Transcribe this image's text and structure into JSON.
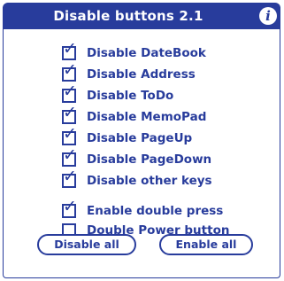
{
  "app": {
    "title": "Disable buttons 2.1",
    "info_icon_glyph": "i"
  },
  "options": [
    {
      "label": "Disable DateBook",
      "checked": true
    },
    {
      "label": "Disable Address",
      "checked": true
    },
    {
      "label": "Disable ToDo",
      "checked": true
    },
    {
      "label": "Disable MemoPad",
      "checked": true
    },
    {
      "label": "Disable PageUp",
      "checked": true
    },
    {
      "label": "Disable PageDown",
      "checked": true
    },
    {
      "label": "Disable other keys",
      "checked": true
    },
    {
      "label": "Enable double press",
      "checked": true
    },
    {
      "label": "Double Power button",
      "checked": false
    }
  ],
  "buttons": {
    "disable_all": "Disable all",
    "enable_all": "Enable all"
  },
  "colors": {
    "accent": "#283c9c",
    "background": "#ffffff"
  },
  "icons": {
    "info": "info-icon",
    "checkbox_checked": "checkmark-icon"
  }
}
